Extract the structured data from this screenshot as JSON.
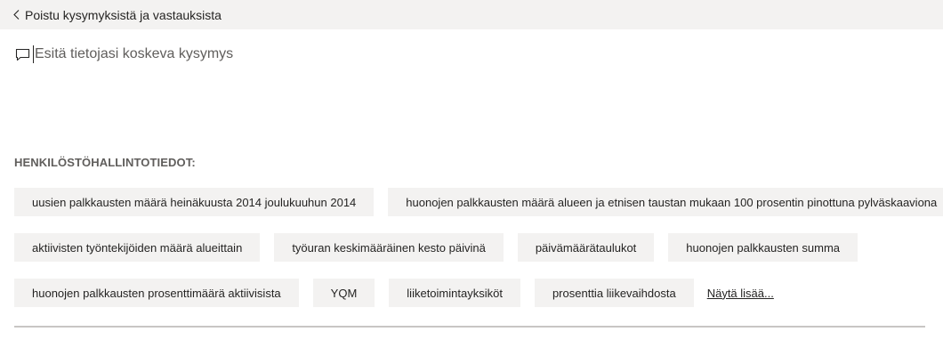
{
  "back": {
    "label": "Poistu kysymyksistä ja vastauksista",
    "icon": "chevron-left-icon"
  },
  "qa": {
    "icon": "chat-bubble-icon",
    "placeholder": "Esitä tietojasi koskeva kysymys",
    "value": ""
  },
  "suggestions": {
    "heading": "HENKILÖSTÖHALLINTOTIEDOT:",
    "row1": [
      "uusien palkkausten määrä heinäkuusta 2014 joulukuuhun 2014",
      "huonojen palkkausten määrä alueen ja etnisen taustan mukaan 100 prosentin pinottuna pylväskaaviona"
    ],
    "row2": [
      "aktiivisten työntekijöiden määrä alueittain",
      "työuran keskimääräinen kesto päivinä",
      "päivämäärätaulukot",
      "huonojen palkkausten summa"
    ],
    "row3": [
      "huonojen palkkausten prosenttimäärä aktiivisista",
      "YQM",
      "liiketoimintayksiköt",
      "prosenttia liikevaihdosta"
    ],
    "show_more": "Näytä lisää..."
  },
  "colors": {
    "topbar_bg": "#f3f2f1",
    "chip_bg": "#f3f2f1",
    "text": "#252423",
    "heading": "#605e5c",
    "divider": "#c8c6c4"
  }
}
